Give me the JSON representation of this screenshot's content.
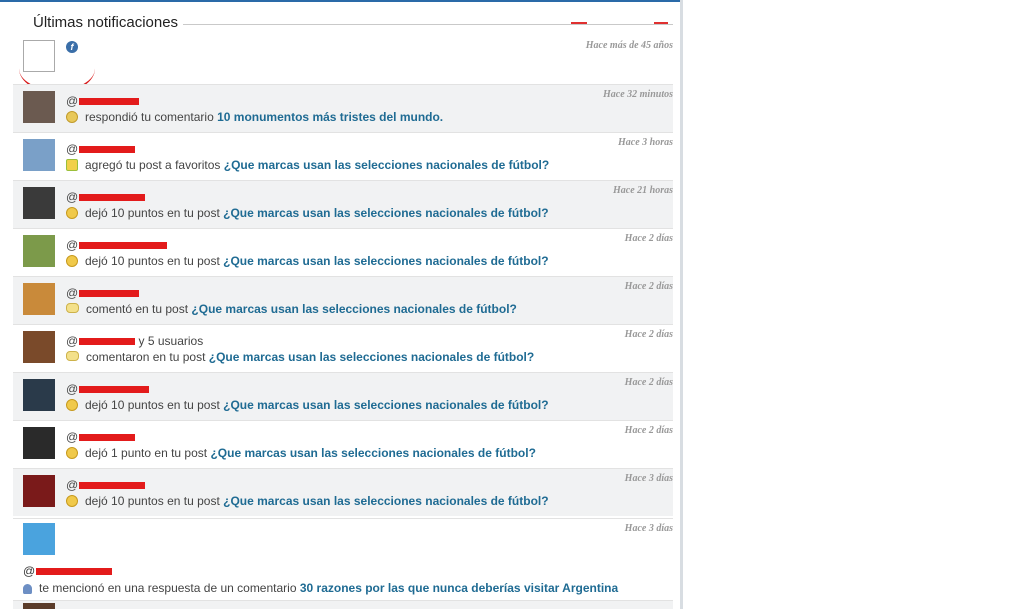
{
  "panel_title": "Últimas notificaciones",
  "first_item": {
    "time": "Hace más de 45 años",
    "icon": "flash-icon"
  },
  "items": [
    {
      "user_prefix": "@",
      "extra": "",
      "icon": "key-icon",
      "action": "respondió tu comentario",
      "link": "10 monumentos más tristes del mundo.",
      "time": "Hace 32 minutos",
      "avatar_color": "#6b5a50"
    },
    {
      "user_prefix": "@",
      "extra": "",
      "icon": "star-add-icon",
      "action": "agregó tu post a favoritos",
      "link": "¿Que marcas usan las selecciones nacionales de fútbol?",
      "time": "Hace 3 horas",
      "avatar_color": "#7aa0c8"
    },
    {
      "user_prefix": "@",
      "extra": "",
      "icon": "coin-icon",
      "action": "dejó 10 puntos en tu post",
      "link": "¿Que marcas usan las selecciones nacionales de fútbol?",
      "time": "Hace 21 horas",
      "avatar_color": "#3a3a3a"
    },
    {
      "user_prefix": "@",
      "extra": "",
      "icon": "coin-icon",
      "action": "dejó 10 puntos en tu post",
      "link": "¿Que marcas usan las selecciones nacionales de fútbol?",
      "time": "Hace 2 días",
      "avatar_color": "#7c9a4a"
    },
    {
      "user_prefix": "@",
      "extra": "",
      "icon": "comment-icon",
      "action": "comentó en tu post",
      "link": "¿Que marcas usan las selecciones nacionales de fútbol?",
      "time": "Hace 2 días",
      "avatar_color": "#c98a3a"
    },
    {
      "user_prefix": "@",
      "extra": "y 5 usuarios",
      "icon": "comment-icon",
      "action": "comentaron en tu post",
      "link": "¿Que marcas usan las selecciones nacionales de fútbol?",
      "time": "Hace 2 días",
      "avatar_color": "#7a4a2a"
    },
    {
      "user_prefix": "@",
      "extra": "",
      "icon": "coin-icon",
      "action": "dejó 10 puntos en tu post",
      "link": "¿Que marcas usan las selecciones nacionales de fútbol?",
      "time": "Hace 2 días",
      "avatar_color": "#2a3a4a"
    },
    {
      "user_prefix": "@",
      "extra": "",
      "icon": "coin-icon",
      "action": "dejó 1 punto en tu post",
      "link": "¿Que marcas usan las selecciones nacionales de fútbol?",
      "time": "Hace 2 días",
      "avatar_color": "#2a2a2a"
    },
    {
      "user_prefix": "@",
      "extra": "",
      "icon": "coin-icon",
      "action": "dejó 10 puntos en tu post",
      "link": "¿Que marcas usan las selecciones nacionales de fútbol?",
      "time": "Hace 3 días",
      "avatar_color": "#7a1a1a"
    }
  ],
  "last_item": {
    "user_prefix": "@",
    "icon": "user-icon",
    "action": "te mencionó en una respuesta de un comentario",
    "link": "30 razones por las que nunca deberías visitar Argentina",
    "time": "Hace 3 días"
  },
  "colors": {
    "link": "#1f6b93",
    "redaction": "#e31b1b",
    "alt_row": "#f1f2f3"
  }
}
